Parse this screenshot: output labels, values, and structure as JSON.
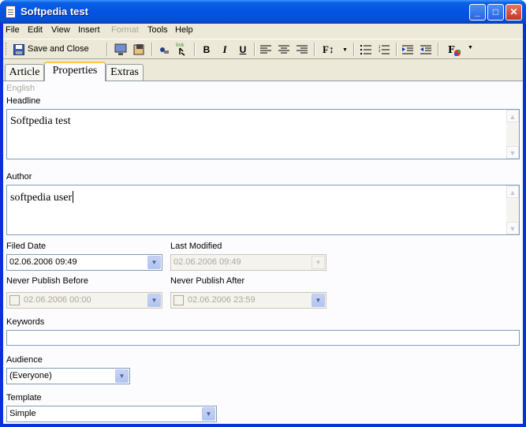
{
  "window": {
    "title": "Softpedia test"
  },
  "menubar": {
    "items": [
      "File",
      "Edit",
      "View",
      "Insert",
      "Format",
      "Tools",
      "Help"
    ]
  },
  "toolbar": {
    "save_close_label": "Save and Close",
    "font_size_label": "F↕"
  },
  "tabs": [
    "Article",
    "Properties",
    "Extras"
  ],
  "form": {
    "language_label": "English",
    "headline_label": "Headline",
    "headline_value": "Softpedia test",
    "author_label": "Author",
    "author_value": "softpedia user",
    "filed_date_label": "Filed Date",
    "filed_date_value": "02.06.2006 09:49",
    "last_modified_label": "Last Modified",
    "last_modified_value": "02.06.2006 09:49",
    "never_before_label": "Never Publish Before",
    "never_before_value": "02.06.2006 00:00",
    "never_after_label": "Never Publish After",
    "never_after_value": "02.06.2006 23:59",
    "keywords_label": "Keywords",
    "keywords_value": "",
    "audience_label": "Audience",
    "audience_value": "(Everyone)",
    "template_label": "Template",
    "template_value": "Simple"
  },
  "colors": {
    "title_bar": "#0454e2",
    "dialog_bg": "#ece9d8",
    "panel_bg": "#fcfcfe"
  }
}
